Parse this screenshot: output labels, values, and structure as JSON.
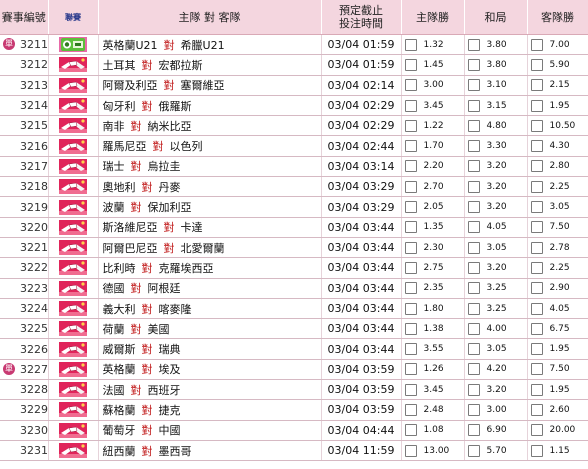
{
  "header": {
    "num": "賽事編號",
    "league": "聯賽",
    "match": "主隊 對 客隊",
    "time_line1": "預定截止",
    "time_line2": "投注時間",
    "home": "主隊勝",
    "draw": "和局",
    "away": "客隊勝"
  },
  "vs_label": "對",
  "rows": [
    {
      "badge": "單",
      "num": "3211",
      "league_icon": "green-pink-badge-icon",
      "home": "英格蘭U21",
      "away": "希臘U21",
      "time": "03/04 01:59",
      "h": "1.32",
      "d": "3.80",
      "a": "7.00"
    },
    {
      "badge": "",
      "num": "3212",
      "league_icon": "handshake-flag-icon",
      "home": "土耳其",
      "away": "宏都拉斯",
      "time": "03/04 01:59",
      "h": "1.45",
      "d": "3.80",
      "a": "5.90"
    },
    {
      "badge": "",
      "num": "3213",
      "league_icon": "handshake-flag-icon",
      "home": "阿爾及利亞",
      "away": "塞爾維亞",
      "time": "03/04 02:14",
      "h": "3.00",
      "d": "3.10",
      "a": "2.15"
    },
    {
      "badge": "",
      "num": "3214",
      "league_icon": "handshake-flag-icon",
      "home": "匈牙利",
      "away": "俄羅斯",
      "time": "03/04 02:29",
      "h": "3.45",
      "d": "3.15",
      "a": "1.95"
    },
    {
      "badge": "",
      "num": "3215",
      "league_icon": "handshake-flag-icon",
      "home": "南非",
      "away": "納米比亞",
      "time": "03/04 02:29",
      "h": "1.22",
      "d": "4.80",
      "a": "10.50"
    },
    {
      "badge": "",
      "num": "3216",
      "league_icon": "handshake-flag-icon",
      "home": "羅馬尼亞",
      "away": "以色列",
      "time": "03/04 02:44",
      "h": "1.70",
      "d": "3.30",
      "a": "4.30"
    },
    {
      "badge": "",
      "num": "3217",
      "league_icon": "handshake-flag-icon",
      "home": "瑞士",
      "away": "烏拉圭",
      "time": "03/04 03:14",
      "h": "2.20",
      "d": "3.20",
      "a": "2.80"
    },
    {
      "badge": "",
      "num": "3218",
      "league_icon": "handshake-flag-icon",
      "home": "奧地利",
      "away": "丹麥",
      "time": "03/04 03:29",
      "h": "2.70",
      "d": "3.20",
      "a": "2.25"
    },
    {
      "badge": "",
      "num": "3219",
      "league_icon": "handshake-flag-icon",
      "home": "波蘭",
      "away": "保加利亞",
      "time": "03/04 03:29",
      "h": "2.05",
      "d": "3.20",
      "a": "3.05"
    },
    {
      "badge": "",
      "num": "3220",
      "league_icon": "handshake-flag-icon",
      "home": "斯洛維尼亞",
      "away": "卡達",
      "time": "03/04 03:44",
      "h": "1.35",
      "d": "4.05",
      "a": "7.50"
    },
    {
      "badge": "",
      "num": "3221",
      "league_icon": "handshake-flag-icon",
      "home": "阿爾巴尼亞",
      "away": "北愛爾蘭",
      "time": "03/04 03:44",
      "h": "2.30",
      "d": "3.05",
      "a": "2.78"
    },
    {
      "badge": "",
      "num": "3222",
      "league_icon": "handshake-flag-icon",
      "home": "比利時",
      "away": "克羅埃西亞",
      "time": "03/04 03:44",
      "h": "2.75",
      "d": "3.20",
      "a": "2.25"
    },
    {
      "badge": "",
      "num": "3223",
      "league_icon": "handshake-flag-icon",
      "home": "德國",
      "away": "阿根廷",
      "time": "03/04 03:44",
      "h": "2.35",
      "d": "3.25",
      "a": "2.90"
    },
    {
      "badge": "",
      "num": "3224",
      "league_icon": "handshake-flag-icon",
      "home": "義大利",
      "away": "喀麥隆",
      "time": "03/04 03:44",
      "h": "1.80",
      "d": "3.25",
      "a": "4.05"
    },
    {
      "badge": "",
      "num": "3225",
      "league_icon": "handshake-flag-icon",
      "home": "荷蘭",
      "away": "美國",
      "time": "03/04 03:44",
      "h": "1.38",
      "d": "4.00",
      "a": "6.75"
    },
    {
      "badge": "",
      "num": "3226",
      "league_icon": "handshake-flag-icon",
      "home": "威爾斯",
      "away": "瑞典",
      "time": "03/04 03:44",
      "h": "3.55",
      "d": "3.05",
      "a": "1.95"
    },
    {
      "badge": "單",
      "num": "3227",
      "league_icon": "handshake-flag-icon",
      "home": "英格蘭",
      "away": "埃及",
      "time": "03/04 03:59",
      "h": "1.26",
      "d": "4.20",
      "a": "7.50"
    },
    {
      "badge": "",
      "num": "3228",
      "league_icon": "handshake-flag-icon",
      "home": "法國",
      "away": "西班牙",
      "time": "03/04 03:59",
      "h": "3.45",
      "d": "3.20",
      "a": "1.95"
    },
    {
      "badge": "",
      "num": "3229",
      "league_icon": "handshake-flag-icon",
      "home": "蘇格蘭",
      "away": "捷克",
      "time": "03/04 03:59",
      "h": "2.48",
      "d": "3.00",
      "a": "2.60"
    },
    {
      "badge": "",
      "num": "3230",
      "league_icon": "handshake-flag-icon",
      "home": "葡萄牙",
      "away": "中國",
      "time": "03/04 04:44",
      "h": "1.08",
      "d": "6.90",
      "a": "20.00"
    },
    {
      "badge": "",
      "num": "3231",
      "league_icon": "handshake-flag-icon",
      "home": "紐西蘭",
      "away": "墨西哥",
      "time": "03/04 11:59",
      "h": "13.00",
      "d": "5.70",
      "a": "1.15"
    }
  ]
}
